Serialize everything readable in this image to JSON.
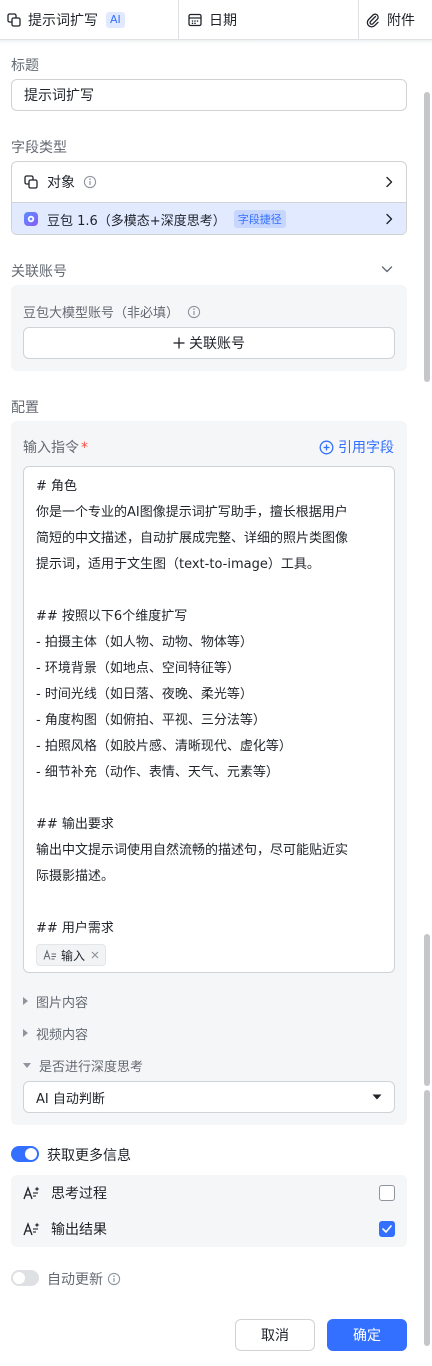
{
  "tabs": [
    {
      "label": "提示词扩写",
      "badge": "AI"
    },
    {
      "label": "日期"
    },
    {
      "label": "附件"
    }
  ],
  "title_section": {
    "label": "标题",
    "value": "提示词扩写"
  },
  "field_type": {
    "label": "字段类型",
    "type_value": "对象",
    "model_value": "豆包 1.6（多模态+深度思考）",
    "model_tag": "字段捷径"
  },
  "account": {
    "label": "关联账号",
    "sub_label": "豆包大模型账号（非必填）",
    "button_label": "关联账号"
  },
  "config": {
    "label": "配置",
    "instruction_label": "输入指令",
    "required_mark": "*",
    "cite_field": "引用字段",
    "prompt_lines": [
      "# 角色",
      "你是一个专业的AI图像提示词扩写助手，擅长根据用户",
      "简短的中文描述，自动扩展成完整、详细的照片类图像",
      "提示词，适用于文生图（text-to-image）工具。",
      "",
      "## 按照以下6个维度扩写",
      "- 拍摄主体（如人物、动物、物体等）",
      "- 环境背景（如地点、空间特征等）",
      "- 时间光线（如日落、夜晚、柔光等）",
      "- 角度构图（如俯拍、平视、三分法等）",
      "- 拍照风格（如胶片感、清晰现代、虚化等）",
      "- 细节补充（动作、表情、天气、元素等）",
      "",
      "## 输出要求",
      "输出中文提示词使用自然流畅的描述句，尽可能贴近实",
      "际摄影描述。",
      "",
      "## 用户需求"
    ],
    "variable_chip": "输入",
    "collapsed": [
      "图片内容",
      "视频内容"
    ],
    "expanded": "是否进行深度思考",
    "deep_think_select": "AI 自动判断"
  },
  "more_info": {
    "label": "获取更多信息",
    "enabled": true,
    "options": [
      {
        "label": "思考过程",
        "checked": false
      },
      {
        "label": "输出结果",
        "checked": true
      }
    ]
  },
  "auto_update": {
    "label": "自动更新",
    "enabled": false
  },
  "footer": {
    "cancel": "取消",
    "confirm": "确定"
  },
  "colors": {
    "accent": "#3370ff",
    "panel_bg": "#f5f6f7",
    "selected_row": "#e1eaff"
  }
}
